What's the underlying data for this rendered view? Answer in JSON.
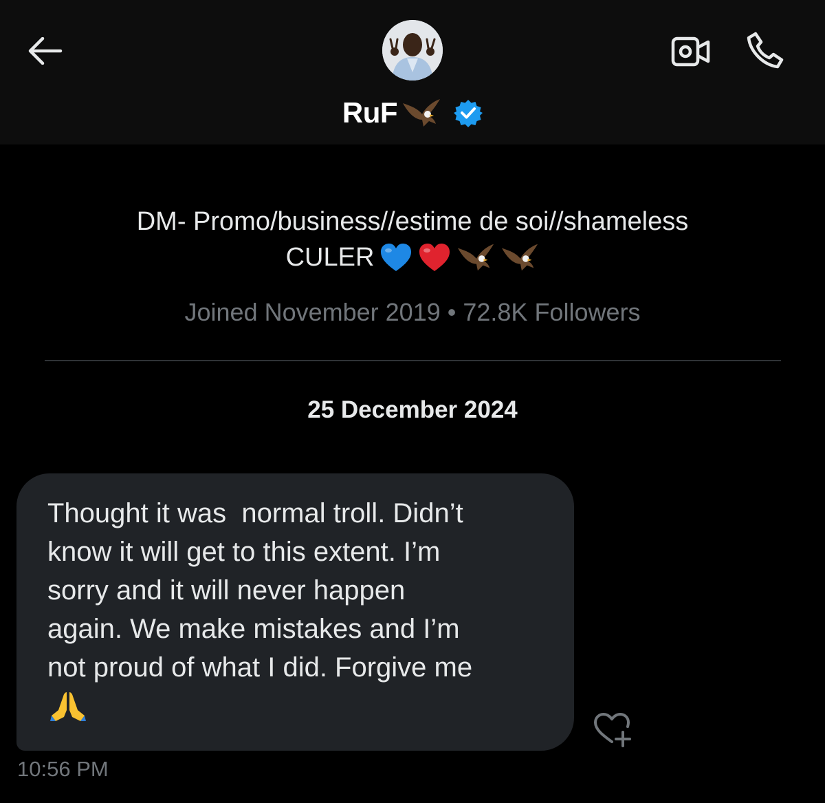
{
  "header": {
    "display_name": "RuF",
    "back_icon": "arrow-left-icon",
    "video_icon": "video-camera-icon",
    "call_icon": "phone-icon",
    "verified_icon": "verified-badge-icon",
    "verified_color": "#1d9bf0"
  },
  "profile": {
    "bio_line1": "DM- Promo/business//estime de soi//shameless",
    "bio_line2": "CULER",
    "meta": "Joined November 2019 • 72.8K Followers"
  },
  "conversation": {
    "date_separator": "25 December 2024",
    "messages": [
      {
        "text": "Thought it was  normal troll. Didn’t\nknow it will get to this extent. I’m\nsorry and it will never happen\nagain. We make mistakes and I’m\nnot proud of what I did. Forgive me",
        "time": "10:56 PM"
      }
    ]
  },
  "colors": {
    "background": "#000000",
    "header_background": "#0d0d0d",
    "bubble": "#202327",
    "secondary_text": "#71767b",
    "divider": "#2f3336"
  }
}
